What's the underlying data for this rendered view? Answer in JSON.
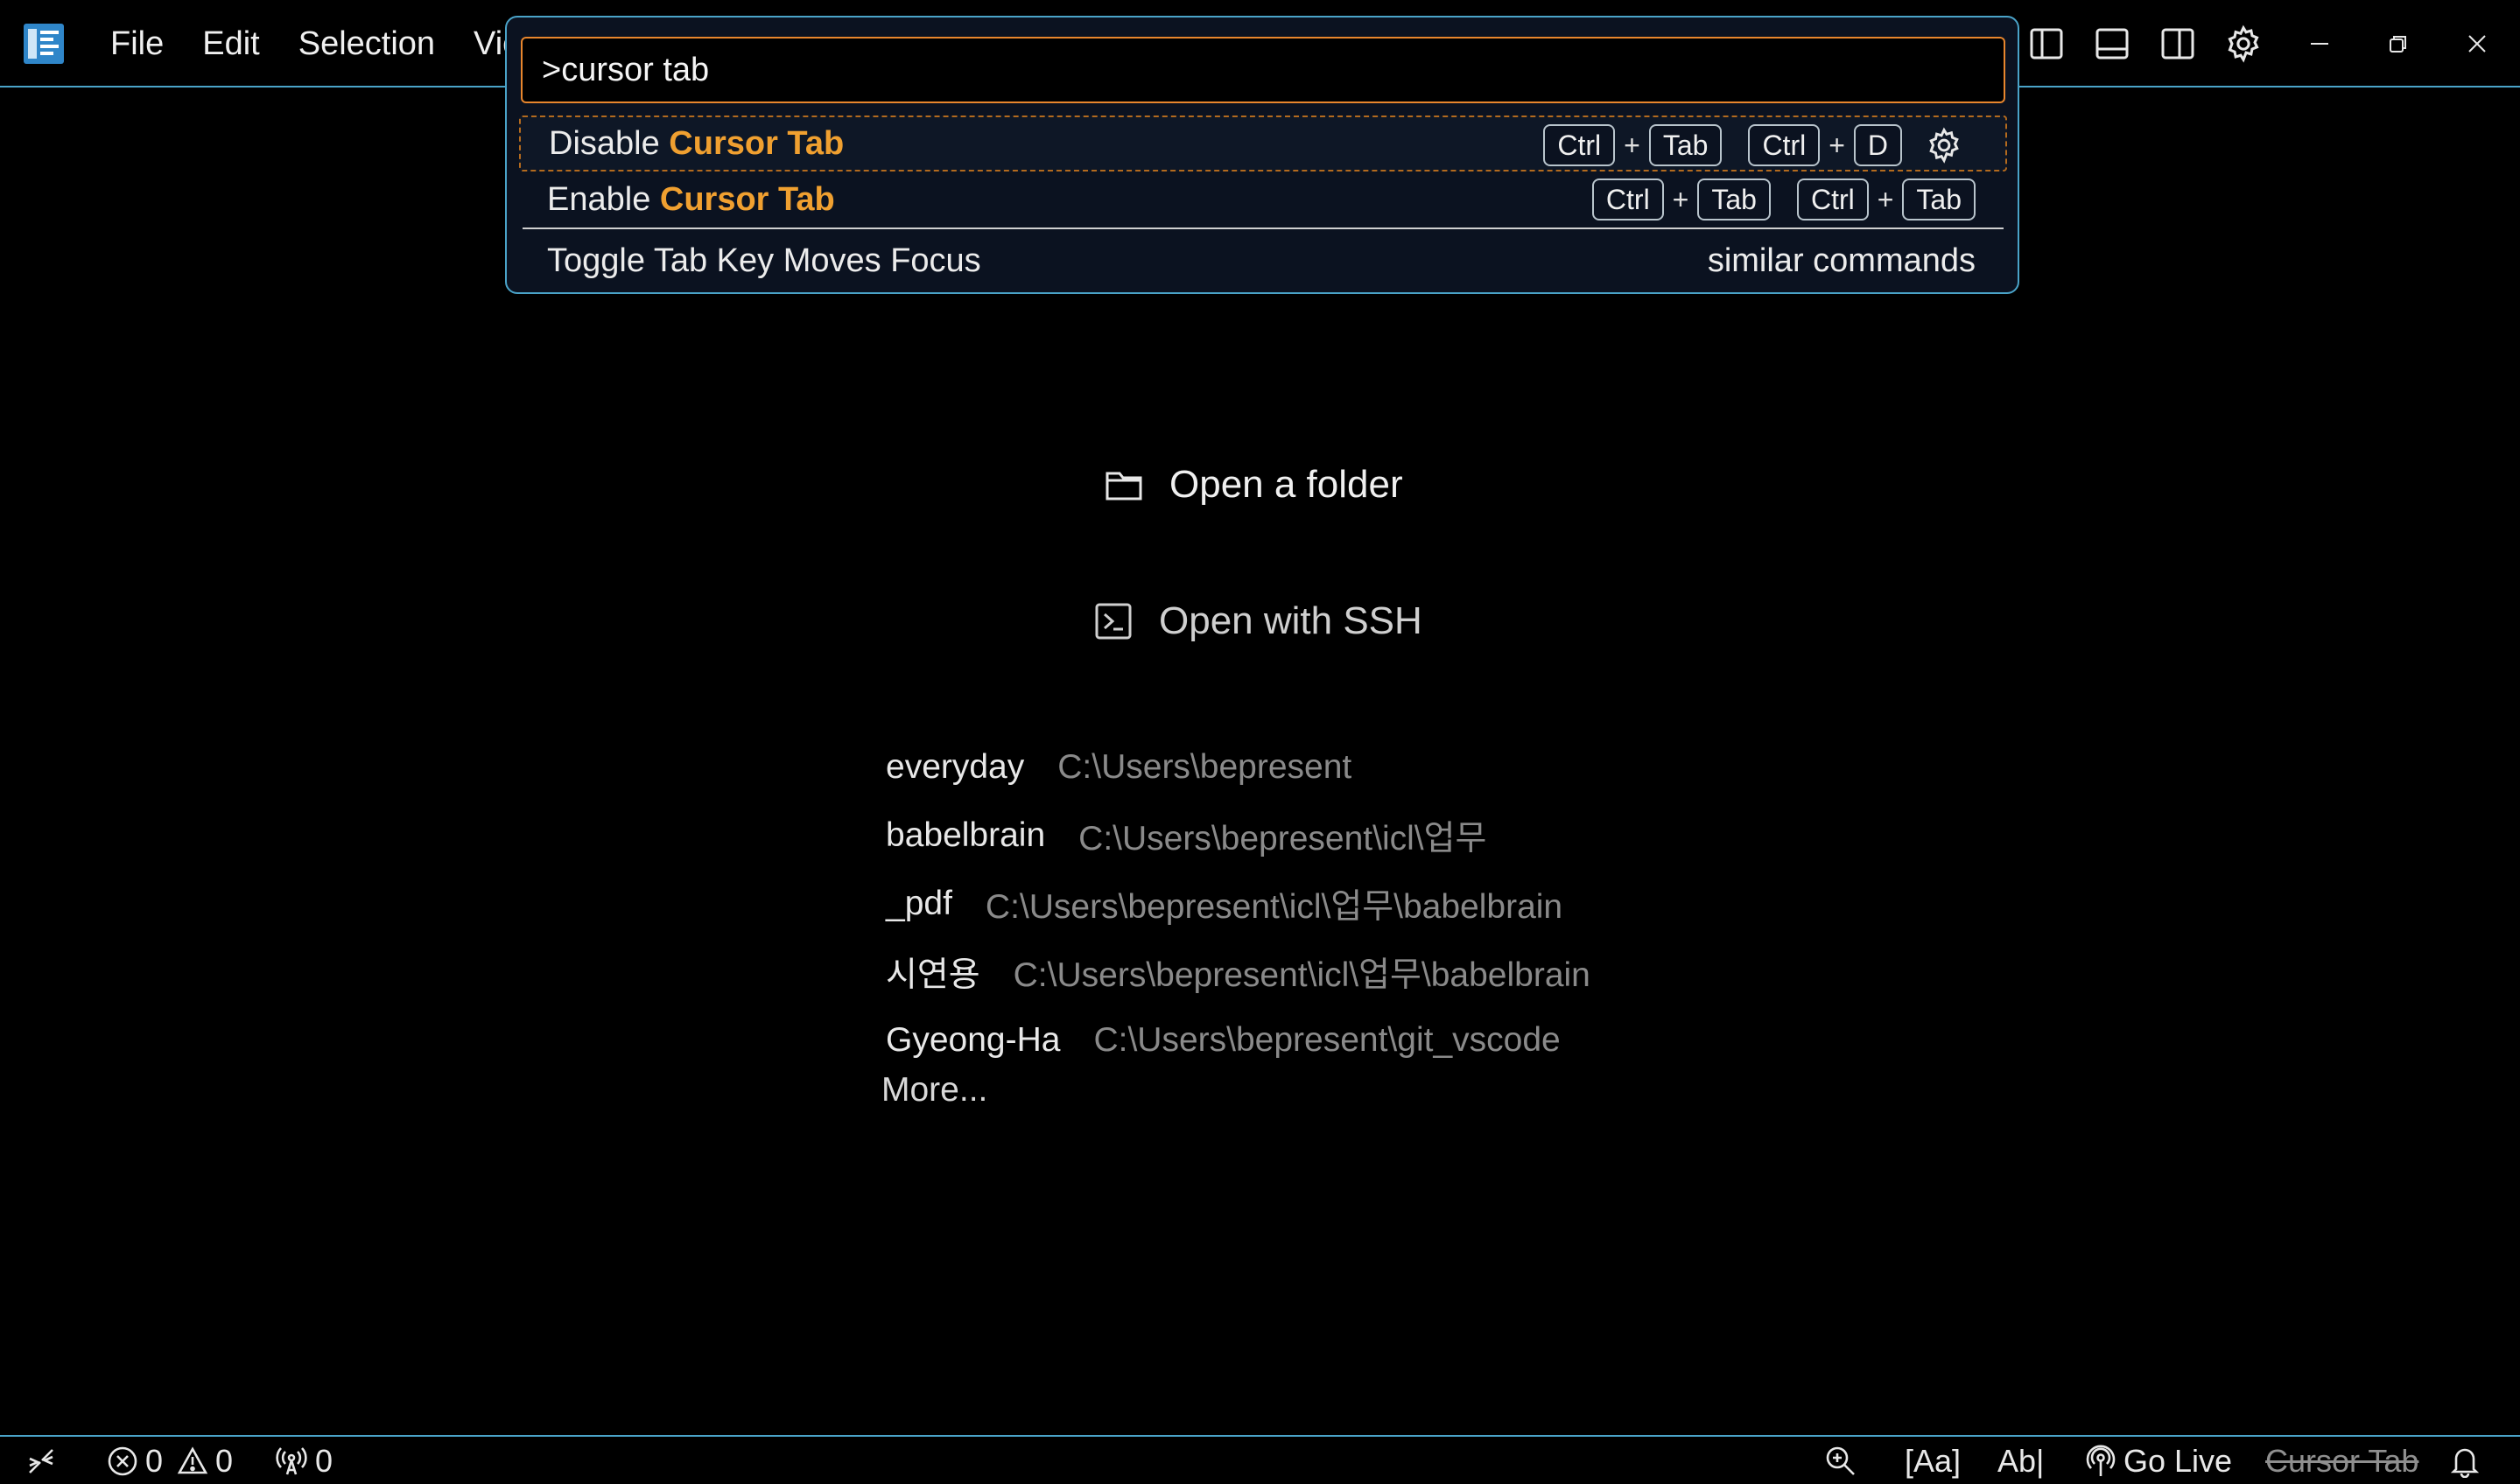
{
  "menu": {
    "items": [
      "File",
      "Edit",
      "Selection",
      "Vie"
    ]
  },
  "palette": {
    "query": ">cursor tab",
    "results": [
      {
        "prefix": "Disable ",
        "highlight": "Cursor Tab",
        "keys1": [
          "Ctrl",
          "Tab"
        ],
        "keys2": [
          "Ctrl",
          "D"
        ]
      },
      {
        "prefix": "Enable ",
        "highlight": "Cursor Tab",
        "keys1": [
          "Ctrl",
          "Tab"
        ],
        "keys2": [
          "Ctrl",
          "Tab"
        ]
      }
    ],
    "plus": "+",
    "toggle": {
      "label": "Toggle Tab Key Moves Focus",
      "hint": "similar commands"
    }
  },
  "welcome": {
    "open_folder": "Open a folder",
    "open_ssh": "Open with SSH",
    "recent": [
      {
        "name": "everyday",
        "path": "C:\\Users\\bepresent"
      },
      {
        "name": "babelbrain",
        "path": "C:\\Users\\bepresent\\icl\\업무"
      },
      {
        "name": "_pdf",
        "path": "C:\\Users\\bepresent\\icl\\업무\\babelbrain"
      },
      {
        "name": "시연용",
        "path": "C:\\Users\\bepresent\\icl\\업무\\babelbrain"
      },
      {
        "name": "Gyeong-Ha",
        "path": "C:\\Users\\bepresent\\git_vscode"
      }
    ],
    "more": "More..."
  },
  "status": {
    "errors": "0",
    "warnings": "0",
    "ports": "0",
    "case_toggle": "[Aa]",
    "word_toggle": "Ab|",
    "go_live": "Go Live",
    "cursor_tab": "Cursor Tab"
  },
  "colors": {
    "accent_border": "#4aa3c8",
    "input_border": "#e8862d",
    "highlight": "#f0a030",
    "palette_bg": "#0b1220"
  }
}
